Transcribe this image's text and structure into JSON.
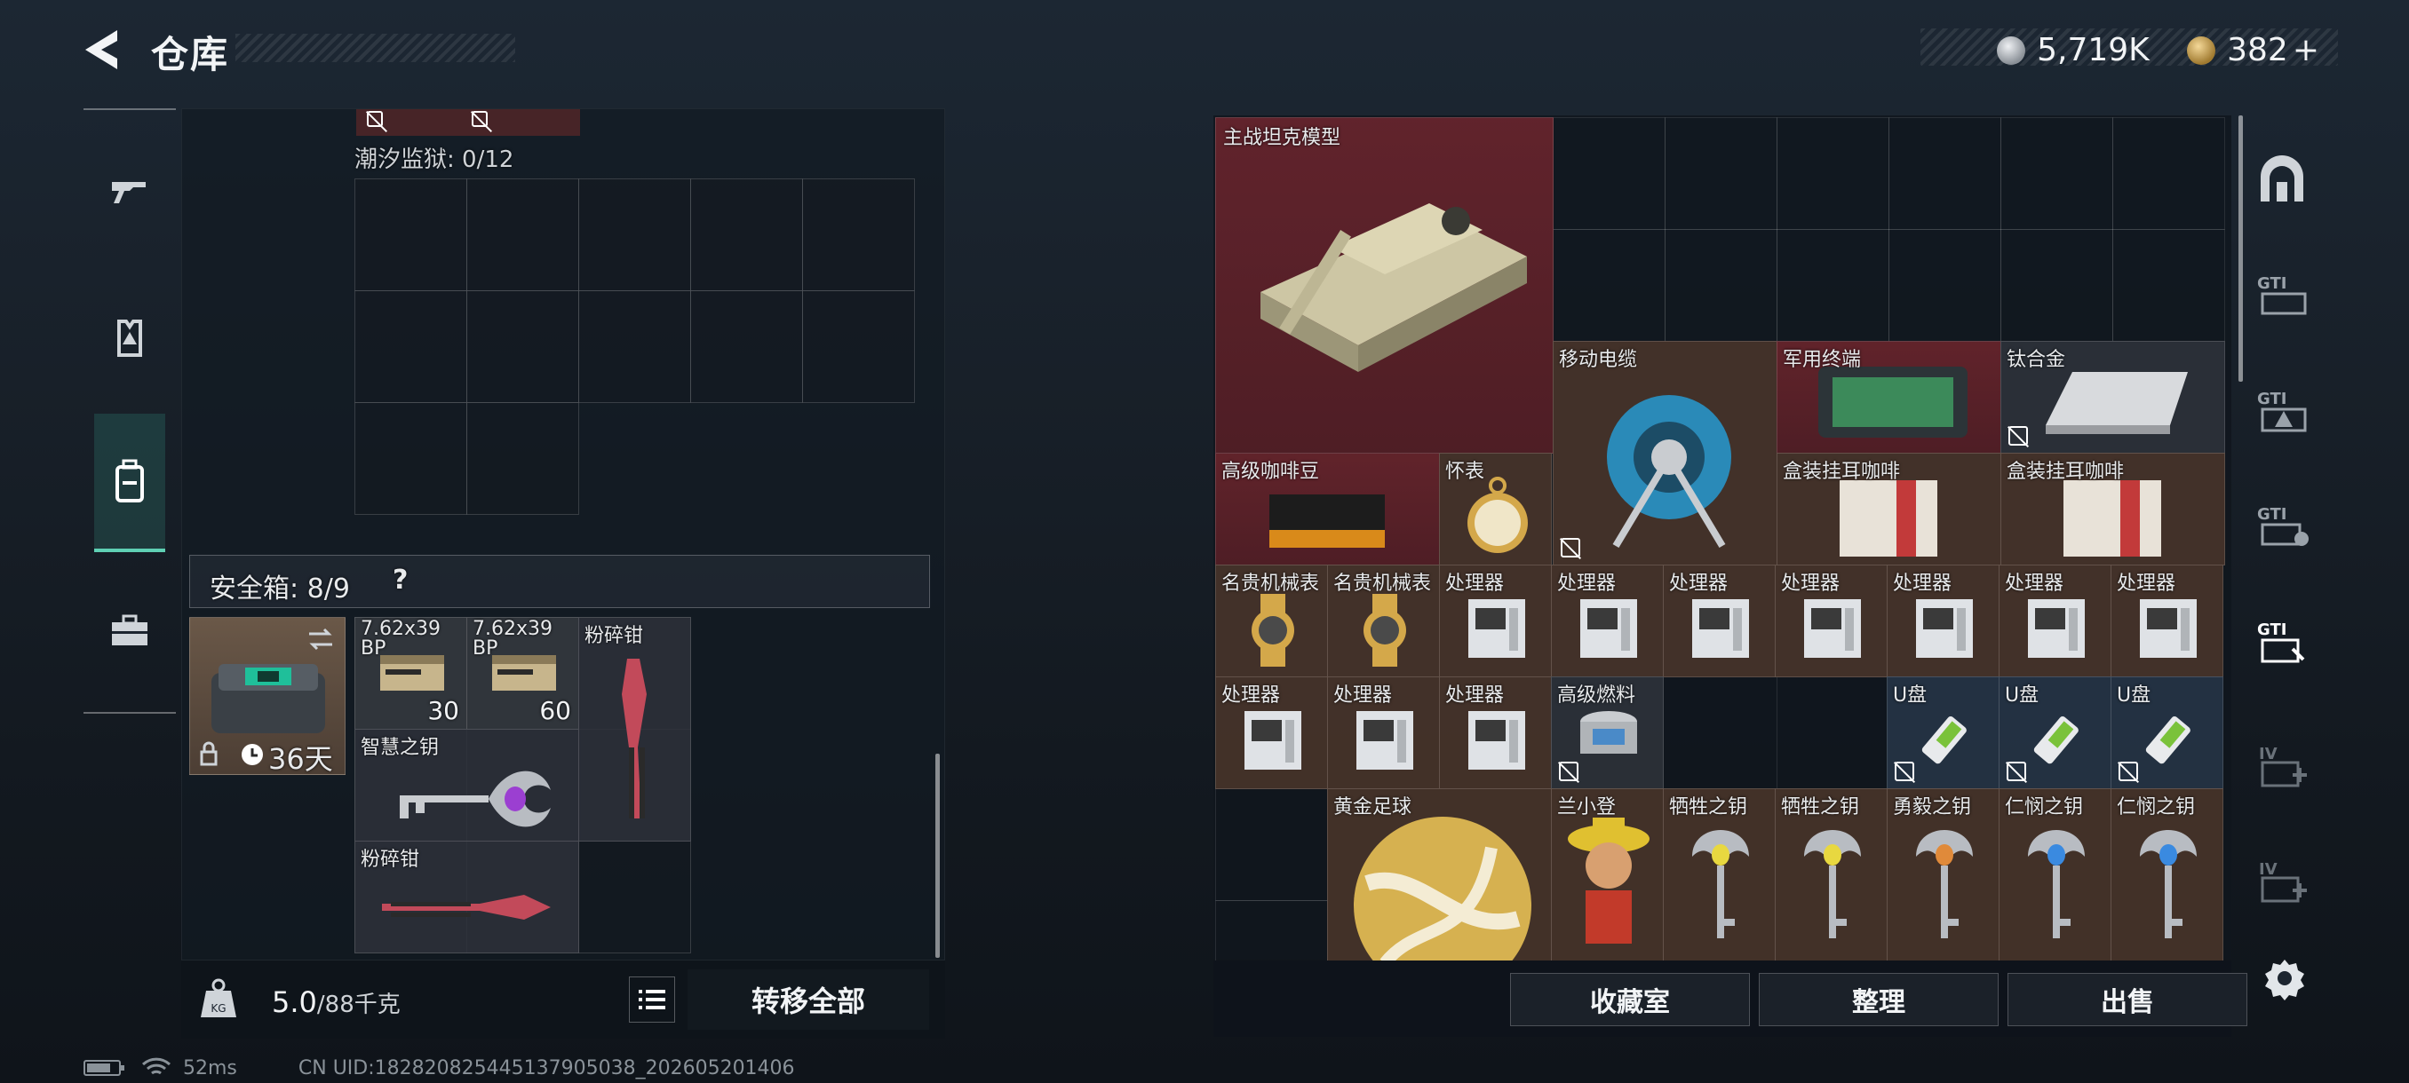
{
  "header": {
    "title": "仓库",
    "currency": [
      {
        "name": "silver-coin-icon",
        "value": "5,719K",
        "color": "#c8ccd2"
      },
      {
        "name": "gold-coin-icon",
        "value": "382",
        "plus": "+",
        "color": "#d9b060"
      }
    ]
  },
  "left_rail": {
    "items": [
      {
        "name": "weapon-tab-icon"
      },
      {
        "name": "armor-tab-icon"
      },
      {
        "name": "backpack-tab-icon",
        "active": true
      },
      {
        "name": "case-tab-icon"
      }
    ]
  },
  "left_panel": {
    "container_label": "潮汐监狱: 0/12",
    "safe_box": {
      "label": "安全箱: 8/9",
      "help": "?",
      "days": "36天",
      "items": [
        {
          "name": "7.62x39 BP",
          "count": "30"
        },
        {
          "name": "7.62x39 BP",
          "count": "60"
        },
        {
          "name": "粉碎钳"
        },
        {
          "name": "智慧之钥"
        },
        {
          "name": "粉碎钳"
        }
      ]
    },
    "weight": {
      "value": "5.0",
      "max": "/88千克",
      "kg": "KG"
    },
    "transfer_all": "转移全部"
  },
  "stash": {
    "items": [
      {
        "label": "主战坦克模型",
        "color": "red"
      },
      {
        "label": "移动电缆",
        "color": "brown",
        "nolock": true
      },
      {
        "label": "军用终端",
        "color": "red"
      },
      {
        "label": "钛合金",
        "color": "gray",
        "nolock": true
      },
      {
        "label": "高级咖啡豆",
        "color": "red"
      },
      {
        "label": "怀表",
        "color": "brown"
      },
      {
        "label": "盒装挂耳咖啡",
        "color": "brown"
      },
      {
        "label": "盒装挂耳咖啡",
        "color": "brown"
      },
      {
        "label": "名贵机械表",
        "color": "brown"
      },
      {
        "label": "名贵机械表",
        "color": "brown"
      },
      {
        "label": "处理器",
        "color": "brown"
      },
      {
        "label": "处理器",
        "color": "brown"
      },
      {
        "label": "处理器",
        "color": "brown"
      },
      {
        "label": "处理器",
        "color": "brown"
      },
      {
        "label": "处理器",
        "color": "brown"
      },
      {
        "label": "处理器",
        "color": "brown"
      },
      {
        "label": "处理器",
        "color": "brown"
      },
      {
        "label": "处理器",
        "color": "brown"
      },
      {
        "label": "处理器",
        "color": "brown"
      },
      {
        "label": "处理器",
        "color": "brown"
      },
      {
        "label": "高级燃料",
        "color": "gray",
        "nolock": true
      },
      {
        "label": "U盘",
        "color": "blue",
        "nolock": true
      },
      {
        "label": "U盘",
        "color": "blue",
        "nolock": true
      },
      {
        "label": "U盘",
        "color": "blue",
        "nolock": true
      },
      {
        "label": "黄金足球",
        "color": "brown"
      },
      {
        "label": "兰小登",
        "color": "brown"
      },
      {
        "label": "牺牲之钥",
        "color": "brown"
      },
      {
        "label": "牺牲之钥",
        "color": "brown"
      },
      {
        "label": "勇毅之钥",
        "color": "brown"
      },
      {
        "label": "仁悯之钥",
        "color": "brown"
      },
      {
        "label": "仁悯之钥",
        "color": "brown"
      }
    ],
    "buttons": {
      "collection": "收藏室",
      "sort": "整理",
      "sell": "出售"
    }
  },
  "right_rail": {
    "icons": [
      {
        "name": "stash-arch-icon"
      },
      {
        "name": "gti-tab-1-icon"
      },
      {
        "name": "gti-tab-2-icon"
      },
      {
        "name": "gti-tab-3-icon"
      },
      {
        "name": "gti-tab-4-icon",
        "active": true
      },
      {
        "name": "iv-add-icon"
      },
      {
        "name": "iv-add-2-icon"
      },
      {
        "name": "settings-icon"
      }
    ]
  },
  "status": {
    "ping": "52ms",
    "uid": "CN UID:182820825445137905038_202605201406"
  }
}
